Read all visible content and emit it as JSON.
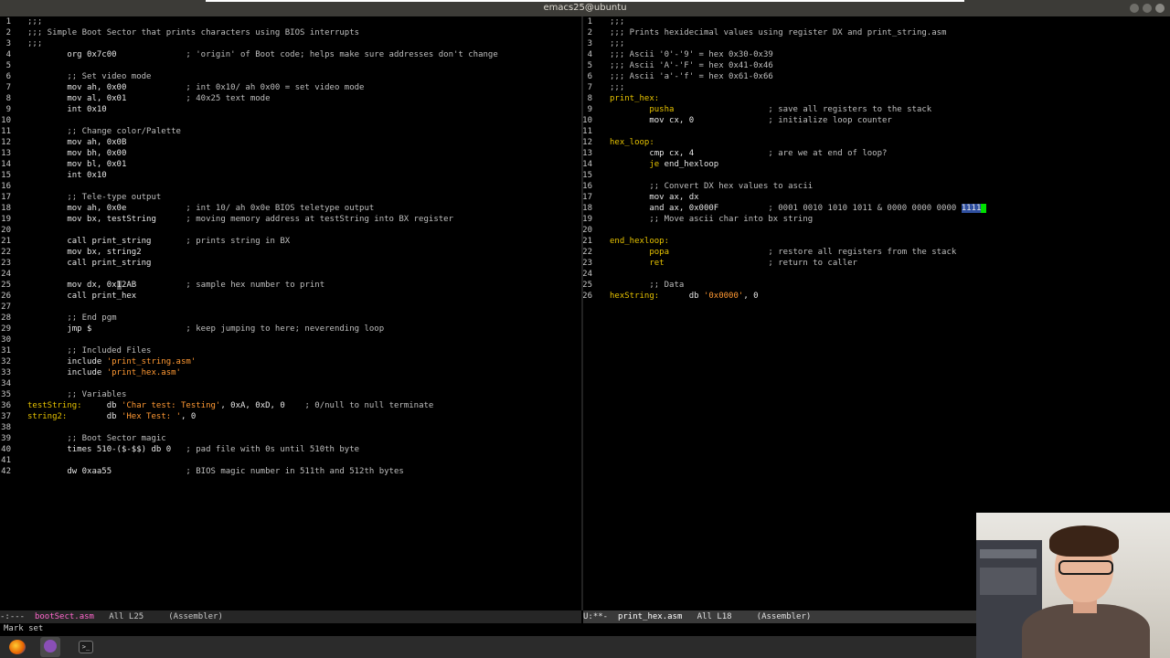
{
  "window": {
    "title": "emacs25@ubuntu"
  },
  "left_pane": {
    "lines": [
      {
        "n": "1",
        "segs": [
          [
            "cm",
            ";;;"
          ]
        ]
      },
      {
        "n": "2",
        "segs": [
          [
            "cm",
            ";;; Simple Boot Sector that prints characters using BIOS interrupts"
          ]
        ]
      },
      {
        "n": "3",
        "segs": [
          [
            "cm",
            ";;;"
          ]
        ]
      },
      {
        "n": "4",
        "segs": [
          [
            "w",
            "        org 0x7c00              "
          ],
          [
            "cm",
            "; 'origin' of Boot code; helps make sure addresses don't change"
          ]
        ]
      },
      {
        "n": "5",
        "segs": []
      },
      {
        "n": "6",
        "segs": [
          [
            "cm",
            "        ;; Set video mode"
          ]
        ]
      },
      {
        "n": "7",
        "segs": [
          [
            "w",
            "        mov ah, 0x00            "
          ],
          [
            "cm",
            "; int 0x10/ ah 0x00 = set video mode"
          ]
        ]
      },
      {
        "n": "8",
        "segs": [
          [
            "w",
            "        mov al, 0x01            "
          ],
          [
            "cm",
            "; 40x25 text mode"
          ]
        ]
      },
      {
        "n": "9",
        "segs": [
          [
            "w",
            "        int 0x10"
          ]
        ]
      },
      {
        "n": "10",
        "segs": []
      },
      {
        "n": "11",
        "segs": [
          [
            "cm",
            "        ;; Change color/Palette"
          ]
        ]
      },
      {
        "n": "12",
        "segs": [
          [
            "w",
            "        mov ah, 0x0B"
          ]
        ]
      },
      {
        "n": "13",
        "segs": [
          [
            "w",
            "        mov bh, 0x00"
          ]
        ]
      },
      {
        "n": "14",
        "segs": [
          [
            "w",
            "        mov bl, 0x01"
          ]
        ]
      },
      {
        "n": "15",
        "segs": [
          [
            "w",
            "        int 0x10"
          ]
        ]
      },
      {
        "n": "16",
        "segs": []
      },
      {
        "n": "17",
        "segs": [
          [
            "cm",
            "        ;; Tele-type output"
          ]
        ]
      },
      {
        "n": "18",
        "segs": [
          [
            "w",
            "        mov ah, 0x0e            "
          ],
          [
            "cm",
            "; int 10/ ah 0x0e BIOS teletype output"
          ]
        ]
      },
      {
        "n": "19",
        "segs": [
          [
            "w",
            "        mov bx, testString      "
          ],
          [
            "cm",
            "; moving memory address at testString into BX register"
          ]
        ]
      },
      {
        "n": "20",
        "segs": []
      },
      {
        "n": "21",
        "segs": [
          [
            "w",
            "        call print_string       "
          ],
          [
            "cm",
            "; prints string in BX"
          ]
        ]
      },
      {
        "n": "22",
        "segs": [
          [
            "w",
            "        mov bx, string2"
          ]
        ]
      },
      {
        "n": "23",
        "segs": [
          [
            "w",
            "        call print_string"
          ]
        ]
      },
      {
        "n": "24",
        "segs": []
      },
      {
        "n": "25",
        "segs": [
          [
            "w",
            "        mov dx, 0x"
          ],
          [
            "cur",
            "1"
          ],
          [
            "w",
            "2AB          "
          ],
          [
            "cm",
            "; sample hex number to print"
          ]
        ]
      },
      {
        "n": "26",
        "segs": [
          [
            "w",
            "        call print_hex"
          ]
        ]
      },
      {
        "n": "27",
        "segs": []
      },
      {
        "n": "28",
        "segs": [
          [
            "cm",
            "        ;; End pgm"
          ]
        ]
      },
      {
        "n": "29",
        "segs": [
          [
            "w",
            "        jmp $                   "
          ],
          [
            "cm",
            "; keep jumping to here; neverending loop"
          ]
        ]
      },
      {
        "n": "30",
        "segs": []
      },
      {
        "n": "31",
        "segs": [
          [
            "cm",
            "        ;; Included Files"
          ]
        ]
      },
      {
        "n": "32",
        "segs": [
          [
            "w",
            "        include "
          ],
          [
            "str",
            "'print_string.asm'"
          ]
        ]
      },
      {
        "n": "33",
        "segs": [
          [
            "w",
            "        include "
          ],
          [
            "str",
            "'print_hex.asm'"
          ]
        ]
      },
      {
        "n": "34",
        "segs": []
      },
      {
        "n": "35",
        "segs": [
          [
            "cm",
            "        ;; Variables"
          ]
        ]
      },
      {
        "n": "36",
        "segs": [
          [
            "lbl",
            "testString:"
          ],
          [
            "w",
            "     db "
          ],
          [
            "str",
            "'Char test: Testing'"
          ],
          [
            "w",
            ", 0xA, 0xD, 0    "
          ],
          [
            "cm",
            "; 0/null to null terminate"
          ]
        ]
      },
      {
        "n": "37",
        "segs": [
          [
            "lbl",
            "string2:"
          ],
          [
            "w",
            "        db "
          ],
          [
            "str",
            "'Hex Test: '"
          ],
          [
            "w",
            ", 0"
          ]
        ]
      },
      {
        "n": "38",
        "segs": []
      },
      {
        "n": "39",
        "segs": [
          [
            "cm",
            "        ;; Boot Sector magic"
          ]
        ]
      },
      {
        "n": "40",
        "segs": [
          [
            "w",
            "        times 510-($-$$) db 0   "
          ],
          [
            "cm",
            "; pad file with 0s until 510th byte"
          ]
        ]
      },
      {
        "n": "41",
        "segs": []
      },
      {
        "n": "42",
        "segs": [
          [
            "w",
            "        dw 0xaa55               "
          ],
          [
            "cm",
            "; BIOS magic number in 511th and 512th bytes"
          ]
        ]
      }
    ]
  },
  "right_pane": {
    "lines": [
      {
        "n": "1",
        "segs": [
          [
            "cm",
            ";;;"
          ]
        ]
      },
      {
        "n": "2",
        "segs": [
          [
            "cm",
            ";;; Prints hexidecimal values using register DX and print_string.asm"
          ]
        ]
      },
      {
        "n": "3",
        "segs": [
          [
            "cm",
            ";;;"
          ]
        ]
      },
      {
        "n": "4",
        "segs": [
          [
            "cm",
            ";;; Ascii '0'-'9' = hex 0x30-0x39"
          ]
        ]
      },
      {
        "n": "5",
        "segs": [
          [
            "cm",
            ";;; Ascii 'A'-'F' = hex 0x41-0x46"
          ]
        ]
      },
      {
        "n": "6",
        "segs": [
          [
            "cm",
            ";;; Ascii 'a'-'f' = hex 0x61-0x66"
          ]
        ]
      },
      {
        "n": "7",
        "segs": [
          [
            "cm",
            ";;;"
          ]
        ]
      },
      {
        "n": "8",
        "segs": [
          [
            "lbl",
            "print_hex:"
          ]
        ]
      },
      {
        "n": "9",
        "segs": [
          [
            "kw",
            "        pusha"
          ],
          [
            "w",
            "                   "
          ],
          [
            "cm",
            "; save all registers to the stack"
          ]
        ]
      },
      {
        "n": "10",
        "segs": [
          [
            "w",
            "        mov cx, 0               "
          ],
          [
            "cm",
            "; initialize loop counter"
          ]
        ]
      },
      {
        "n": "11",
        "segs": []
      },
      {
        "n": "12",
        "segs": [
          [
            "lbl",
            "hex_loop:"
          ]
        ]
      },
      {
        "n": "13",
        "segs": [
          [
            "w",
            "        cmp cx, 4               "
          ],
          [
            "cm",
            "; are we at end of loop?"
          ]
        ]
      },
      {
        "n": "14",
        "segs": [
          [
            "kw",
            "        je"
          ],
          [
            "w",
            " end_hexloop"
          ]
        ]
      },
      {
        "n": "15",
        "segs": []
      },
      {
        "n": "16",
        "segs": [
          [
            "cm",
            "        ;; Convert DX hex values to ascii"
          ]
        ]
      },
      {
        "n": "17",
        "segs": [
          [
            "w",
            "        mov ax, dx"
          ]
        ]
      },
      {
        "n": "18",
        "segs": [
          [
            "w",
            "        and ax, 0x000F          "
          ],
          [
            "cm",
            "; 0001 0010 1010 1011 & 0000 0000 0000 "
          ],
          [
            "reg",
            "1111"
          ],
          [
            "gcur",
            ""
          ]
        ]
      },
      {
        "n": "19",
        "segs": [
          [
            "cm",
            "        ;; Move ascii char into bx string"
          ]
        ]
      },
      {
        "n": "20",
        "segs": []
      },
      {
        "n": "21",
        "segs": [
          [
            "lbl",
            "end_hexloop:"
          ]
        ]
      },
      {
        "n": "22",
        "segs": [
          [
            "kw",
            "        popa"
          ],
          [
            "w",
            "                    "
          ],
          [
            "cm",
            "; restore all registers from the stack"
          ]
        ]
      },
      {
        "n": "23",
        "segs": [
          [
            "kw",
            "        ret"
          ],
          [
            "w",
            "                     "
          ],
          [
            "cm",
            "; return to caller"
          ]
        ]
      },
      {
        "n": "24",
        "segs": []
      },
      {
        "n": "25",
        "segs": [
          [
            "cm",
            "        ;; Data"
          ]
        ]
      },
      {
        "n": "26",
        "segs": [
          [
            "lbl",
            "hexString:"
          ],
          [
            "w",
            "      db "
          ],
          [
            "str",
            "'0x0000'"
          ],
          [
            "w",
            ", 0"
          ]
        ]
      }
    ]
  },
  "modeline_left": {
    "status": "-:---  ",
    "buffer": "bootSect.asm",
    "position": "   All L25   ",
    "mode": "  (Assembler)"
  },
  "modeline_right": {
    "status": "U:**-  ",
    "buffer": "print_hex.asm",
    "position": "   All L18   ",
    "mode": "  (Assembler)"
  },
  "echo_area": "Mark set",
  "taskbar": {
    "icons": [
      "firefox-icon",
      "emacs-icon",
      "terminal-icon"
    ],
    "terminal_glyph": ">_"
  }
}
